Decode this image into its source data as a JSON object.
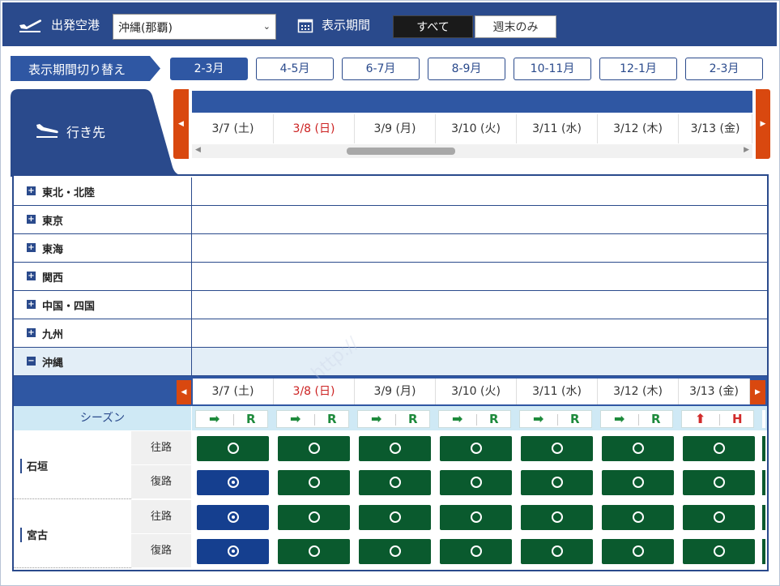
{
  "header": {
    "departure_label": "出発空港",
    "airport_selected": "沖縄(那覇)",
    "period_label": "表示期間",
    "filter_all": "すべて",
    "filter_weekend": "週末のみ"
  },
  "period_switch": {
    "label": "表示期間切り替え",
    "options": [
      "2-3月",
      "4-5月",
      "6-7月",
      "8-9月",
      "10-11月",
      "12-1月",
      "2-3月"
    ],
    "active_index": 0
  },
  "destination_header": "行き先",
  "dates": [
    {
      "label": "3/7 (土)",
      "color": "#333333"
    },
    {
      "label": "3/8 (日)",
      "color": "#cc2222"
    },
    {
      "label": "3/9 (月)",
      "color": "#333333"
    },
    {
      "label": "3/10 (火)",
      "color": "#333333"
    },
    {
      "label": "3/11 (水)",
      "color": "#333333"
    },
    {
      "label": "3/12 (木)",
      "color": "#333333"
    },
    {
      "label": "3/13 (金)",
      "color": "#333333"
    }
  ],
  "regions": [
    {
      "name": "東北・北陸",
      "expanded": false
    },
    {
      "name": "東京",
      "expanded": false
    },
    {
      "name": "東海",
      "expanded": false
    },
    {
      "name": "関西",
      "expanded": false
    },
    {
      "name": "中国・四国",
      "expanded": false
    },
    {
      "name": "九州",
      "expanded": false
    },
    {
      "name": "沖縄",
      "expanded": true
    }
  ],
  "season": {
    "label": "シーズン",
    "cells": [
      {
        "arrow": "➡",
        "letter": "R",
        "color": "#1e8a3c"
      },
      {
        "arrow": "➡",
        "letter": "R",
        "color": "#1e8a3c"
      },
      {
        "arrow": "➡",
        "letter": "R",
        "color": "#1e8a3c"
      },
      {
        "arrow": "➡",
        "letter": "R",
        "color": "#1e8a3c"
      },
      {
        "arrow": "➡",
        "letter": "R",
        "color": "#1e8a3c"
      },
      {
        "arrow": "➡",
        "letter": "R",
        "color": "#1e8a3c"
      },
      {
        "arrow": "⬆",
        "letter": "H",
        "color": "#d12b2b"
      }
    ]
  },
  "destinations": [
    {
      "name": "石垣",
      "outbound_label": "往路",
      "return_label": "復路",
      "outbound": [
        "green",
        "green",
        "green",
        "green",
        "green",
        "green",
        "green"
      ],
      "return": [
        "blue",
        "green",
        "green",
        "green",
        "green",
        "green",
        "green"
      ]
    },
    {
      "name": "宮古",
      "outbound_label": "往路",
      "return_label": "復路",
      "outbound": [
        "blue",
        "green",
        "green",
        "green",
        "green",
        "green",
        "green"
      ],
      "return": [
        "blue",
        "green",
        "green",
        "green",
        "green",
        "green",
        "green"
      ]
    }
  ],
  "colors": {
    "header_navy": "#2a4a8c",
    "accent_blue": "#2f57a3",
    "scroll_arrow": "#d9480f",
    "available_green": "#0a5a2e",
    "few_left_blue": "#153f8f",
    "season_bg": "#cfe9f5"
  }
}
